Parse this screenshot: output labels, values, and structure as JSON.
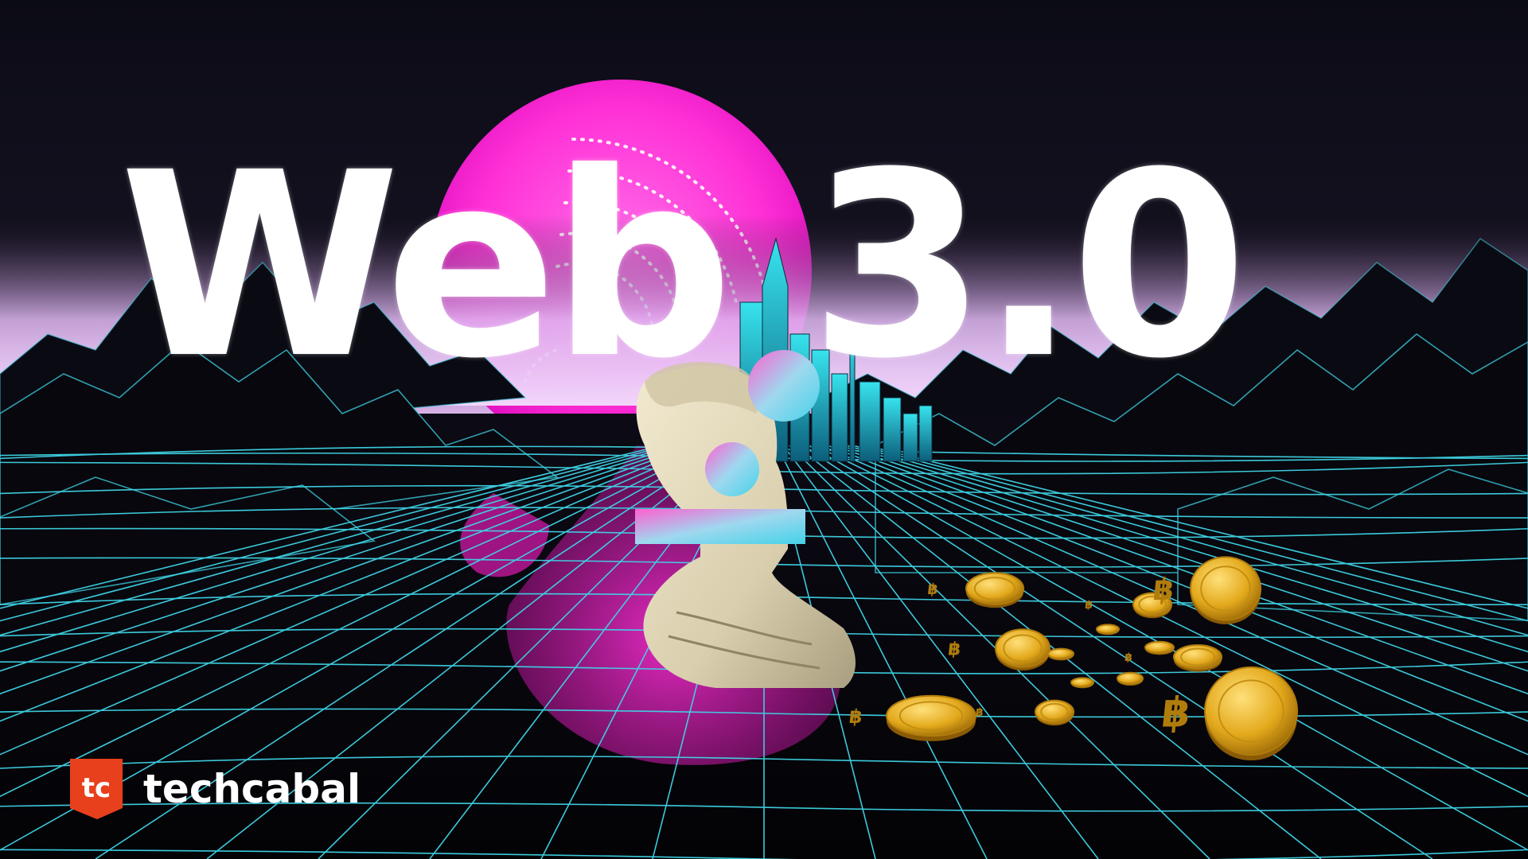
{
  "headline": "Web 3.0",
  "brand": {
    "logo_letters": "tc",
    "name": "techcabal",
    "logo_color": "#e8401c"
  },
  "palette": {
    "sun": "#ff2fd6",
    "grid_line": "#3fd4e6",
    "road": "#c4189e",
    "coin": "#e3a91c"
  },
  "icons": [
    "bitcoin-coin-icon",
    "techcabal-logo-icon"
  ]
}
